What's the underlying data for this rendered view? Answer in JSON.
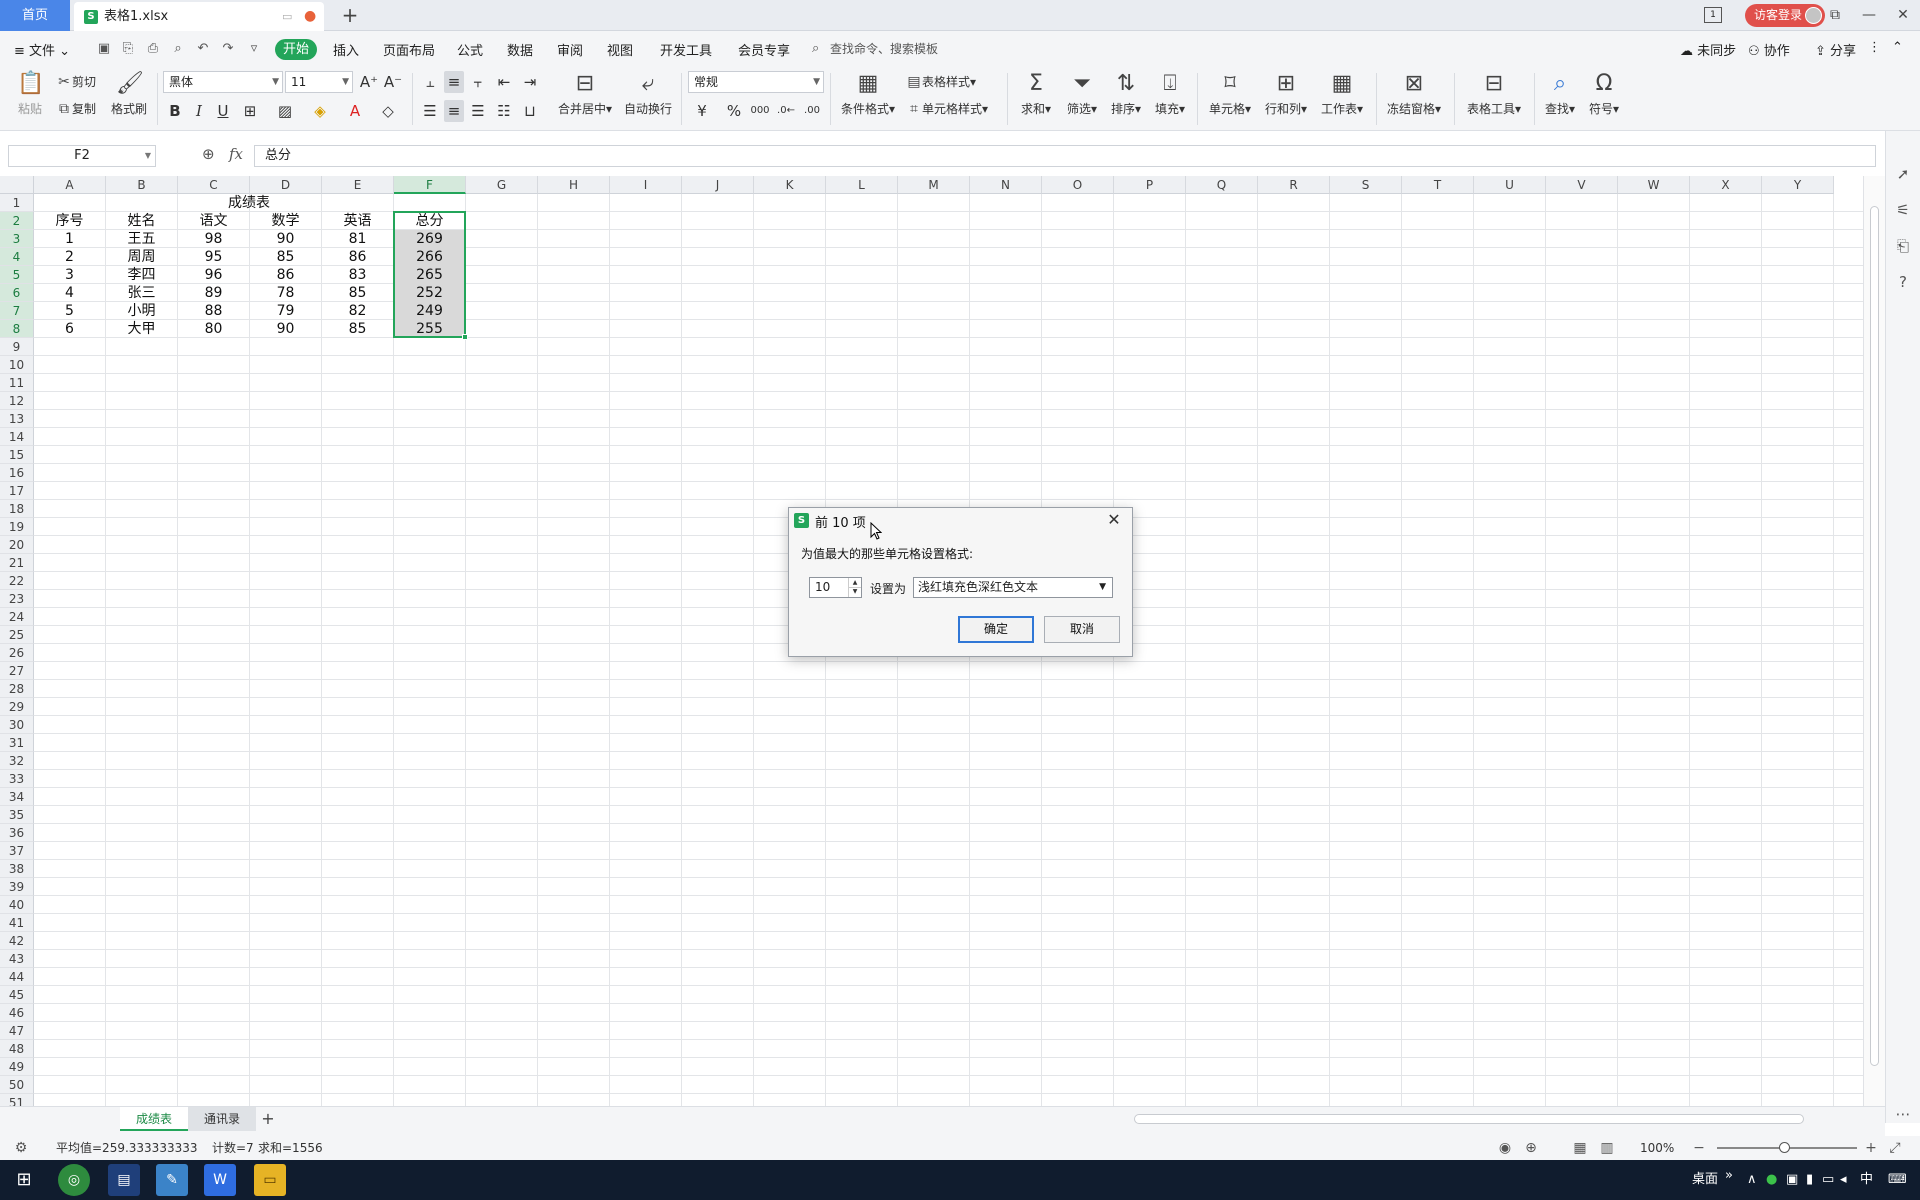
{
  "tabs": {
    "home": "首页",
    "file": "表格1.xlsx",
    "add": "+"
  },
  "window": {
    "login": "访客登录",
    "badge": "1"
  },
  "menu": {
    "file": "文件",
    "items": [
      "开始",
      "插入",
      "页面布局",
      "公式",
      "数据",
      "审阅",
      "视图",
      "开发工具",
      "会员专享"
    ],
    "search": "查找命令、搜索模板",
    "right": [
      "未同步",
      "协作",
      "分享"
    ]
  },
  "ribbon": {
    "paste": "粘贴",
    "cut": "剪切",
    "copy": "复制",
    "format_painter": "格式刷",
    "font": "黑体",
    "size": "11",
    "number_format": "常规",
    "merge": "合并居中",
    "wrap": "自动换行",
    "cond_format": "条件格式",
    "table_style": "表格样式",
    "cell_style": "单元格样式",
    "sum": "求和",
    "filter": "筛选",
    "sort": "排序",
    "fill": "填充",
    "cell": "单元格",
    "rowcol": "行和列",
    "worksheet": "工作表",
    "freeze": "冻结窗格",
    "table_tools": "表格工具",
    "find": "查找",
    "symbol": "符号"
  },
  "formula": {
    "name_box": "F2",
    "fx": "fx",
    "content": "总分"
  },
  "columns": [
    "A",
    "B",
    "C",
    "D",
    "E",
    "F",
    "G",
    "H",
    "I",
    "J",
    "K",
    "L",
    "M",
    "N",
    "O",
    "P",
    "Q",
    "R",
    "S",
    "T",
    "U",
    "V",
    "W",
    "X",
    "Y"
  ],
  "rows_count": 51,
  "table": {
    "title": "成绩表",
    "headers": [
      "序号",
      "姓名",
      "语文",
      "数学",
      "英语",
      "总分"
    ],
    "rows": [
      [
        "1",
        "王五",
        "98",
        "90",
        "81",
        "269"
      ],
      [
        "2",
        "周周",
        "95",
        "85",
        "86",
        "266"
      ],
      [
        "3",
        "李四",
        "96",
        "86",
        "83",
        "265"
      ],
      [
        "4",
        "张三",
        "89",
        "78",
        "85",
        "252"
      ],
      [
        "5",
        "小明",
        "88",
        "79",
        "82",
        "249"
      ],
      [
        "6",
        "大甲",
        "80",
        "90",
        "85",
        "255"
      ]
    ]
  },
  "sheets": [
    "成绩表",
    "通讯录"
  ],
  "status": {
    "average": "平均值=259.333333333",
    "count": "计数=7",
    "sum": "求和=1556",
    "zoom": "100%"
  },
  "taskbar": {
    "desktop": "桌面",
    "ime": "中",
    "arrow": "»"
  },
  "dialog": {
    "title": "前 10 项",
    "description": "为值最大的那些单元格设置格式:",
    "count_value": "10",
    "set_as": "设置为",
    "format_option": "浅红填充色深红色文本",
    "ok": "确定",
    "cancel": "取消"
  },
  "colors": {
    "accent": "#23a55a",
    "tab_home": "#4a86e8",
    "login": "#e0504b"
  }
}
